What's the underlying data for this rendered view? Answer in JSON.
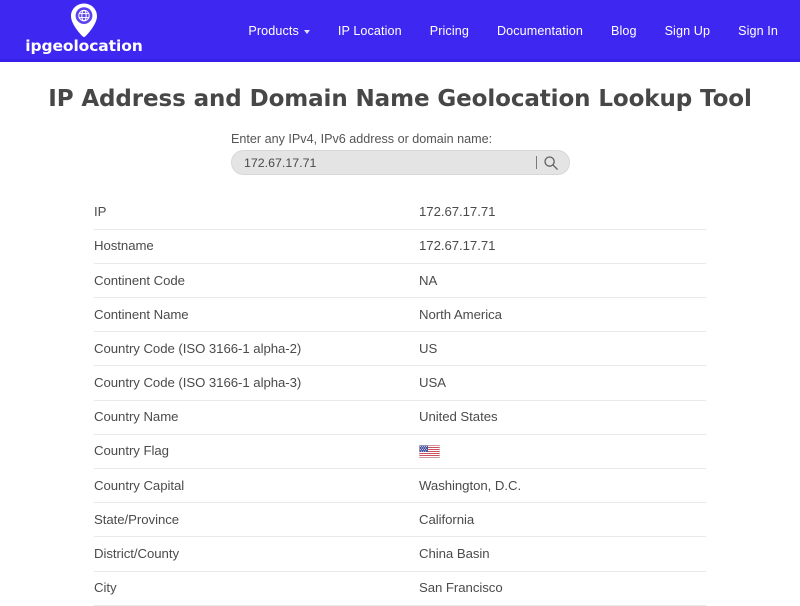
{
  "header": {
    "brand": {
      "wordmark": "ipgeolocation",
      "pin_icon": "map-pin-globe-icon"
    },
    "nav": [
      {
        "label": "Products",
        "has_dropdown": true
      },
      {
        "label": "IP Location",
        "has_dropdown": false
      },
      {
        "label": "Pricing",
        "has_dropdown": false
      },
      {
        "label": "Documentation",
        "has_dropdown": false
      },
      {
        "label": "Blog",
        "has_dropdown": false
      },
      {
        "label": "Sign Up",
        "has_dropdown": false
      },
      {
        "label": "Sign In",
        "has_dropdown": false
      }
    ],
    "background_color": "#3f27f2"
  },
  "main": {
    "title": "IP Address and Domain Name Geolocation Lookup Tool",
    "search": {
      "label": "Enter any IPv4, IPv6 address or domain name:",
      "value": "172.67.17.71",
      "placeholder": "Enter any IPv4, IPv6 address or domain name",
      "icon": "search-icon"
    },
    "results": [
      {
        "key": "IP",
        "value": "172.67.17.71"
      },
      {
        "key": "Hostname",
        "value": "172.67.17.71"
      },
      {
        "key": "Continent Code",
        "value": "NA"
      },
      {
        "key": "Continent Name",
        "value": "North America"
      },
      {
        "key": "Country Code (ISO 3166-1 alpha-2)",
        "value": "US"
      },
      {
        "key": "Country Code (ISO 3166-1 alpha-3)",
        "value": "USA"
      },
      {
        "key": "Country Name",
        "value": "United States"
      },
      {
        "key": "Country Flag",
        "value": "",
        "is_flag": true,
        "flag_name": "united-states-flag"
      },
      {
        "key": "Country Capital",
        "value": "Washington, D.C."
      },
      {
        "key": "State/Province",
        "value": "California"
      },
      {
        "key": "District/County",
        "value": "China Basin"
      },
      {
        "key": "City",
        "value": "San Francisco"
      }
    ]
  }
}
